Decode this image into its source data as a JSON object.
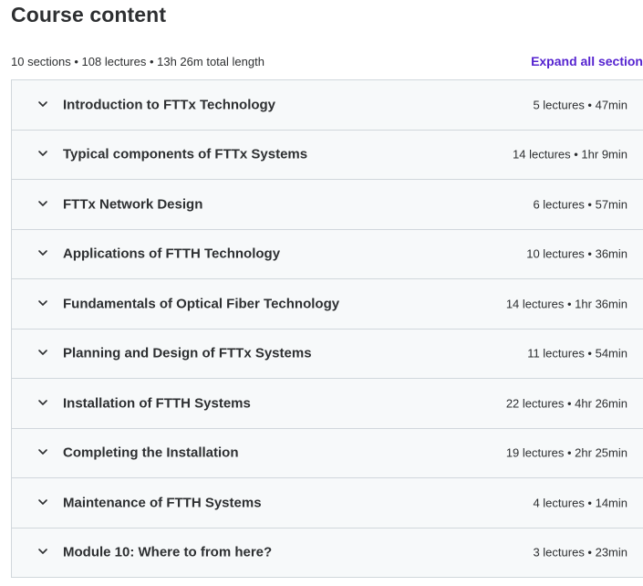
{
  "header": {
    "title": "Course content",
    "summary": "10 sections • 108 lectures • 13h 26m total length",
    "expand_all_label": "Expand all section"
  },
  "accent_color": "#5624d0",
  "icon": "chevron-down-icon",
  "sections": [
    {
      "title": "Introduction to FTTx Technology",
      "meta": "5 lectures • 47min"
    },
    {
      "title": "Typical components of FTTx Systems",
      "meta": "14 lectures • 1hr 9min"
    },
    {
      "title": "FTTx Network Design",
      "meta": "6 lectures • 57min"
    },
    {
      "title": "Applications of FTTH Technology",
      "meta": "10 lectures • 36min"
    },
    {
      "title": "Fundamentals of Optical Fiber Technology",
      "meta": "14 lectures • 1hr 36min"
    },
    {
      "title": "Planning and Design of FTTx Systems",
      "meta": "11 lectures • 54min"
    },
    {
      "title": "Installation of FTTH Systems",
      "meta": "22 lectures • 4hr 26min"
    },
    {
      "title": "Completing the Installation",
      "meta": "19 lectures • 2hr 25min"
    },
    {
      "title": "Maintenance of FTTH Systems",
      "meta": "4 lectures • 14min"
    },
    {
      "title": "Module 10: Where to from here?",
      "meta": "3 lectures • 23min"
    }
  ]
}
